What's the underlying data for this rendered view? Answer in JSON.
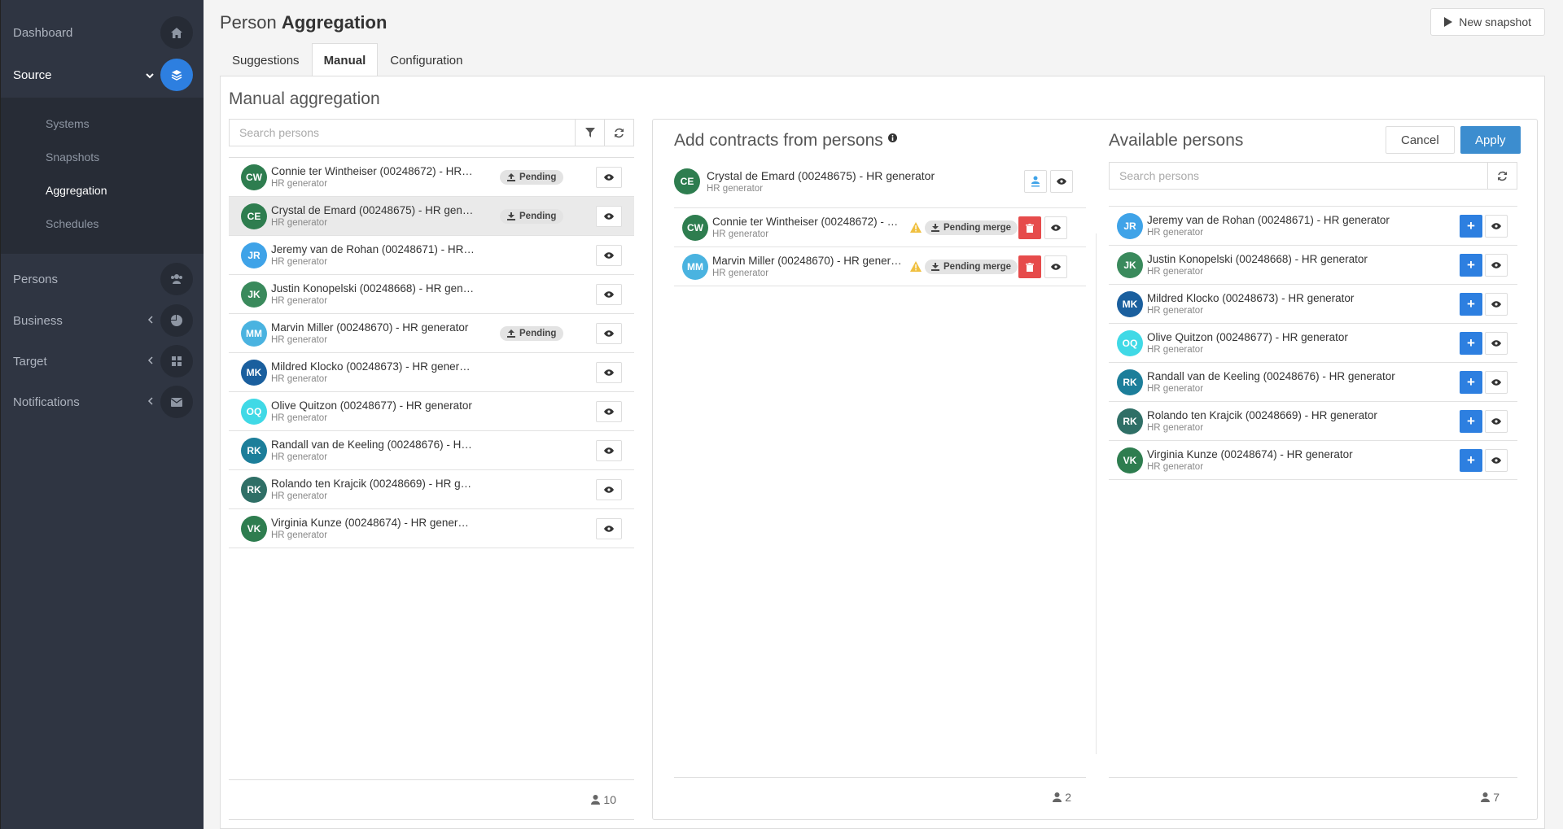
{
  "sidebar": {
    "dashboard": "Dashboard",
    "source": "Source",
    "sub": [
      "Systems",
      "Snapshots",
      "Aggregation",
      "Schedules"
    ],
    "persons": "Persons",
    "business": "Business",
    "target": "Target",
    "notifications": "Notifications"
  },
  "header": {
    "title_light": "Person",
    "title_bold": "Aggregation",
    "new_snapshot": "New snapshot"
  },
  "tabs": [
    "Suggestions",
    "Manual",
    "Configuration"
  ],
  "manual": {
    "title": "Manual aggregation",
    "search_placeholder": "Search persons",
    "count": "10",
    "persons": [
      {
        "initials": "CW",
        "name": "Connie ter Wintheiser (00248672) - HR g...",
        "sub": "HR generator",
        "status": "Pending",
        "color": "#2e7d4f"
      },
      {
        "initials": "CE",
        "name": "Crystal de Emard (00248675) - HR gener...",
        "sub": "HR generator",
        "status": "Pending",
        "color": "#2e7d4f"
      },
      {
        "initials": "JR",
        "name": "Jeremy van de Rohan (00248671) - HR g...",
        "sub": "HR generator",
        "status": "",
        "color": "#3fa3e8"
      },
      {
        "initials": "JK",
        "name": "Justin Konopelski (00248668) - HR gener...",
        "sub": "HR generator",
        "status": "",
        "color": "#3a8a5c"
      },
      {
        "initials": "MM",
        "name": "Marvin Miller (00248670) - HR generator",
        "sub": "HR generator",
        "status": "Pending",
        "color": "#4ab3e0"
      },
      {
        "initials": "MK",
        "name": "Mildred Klocko (00248673) - HR generat...",
        "sub": "HR generator",
        "status": "",
        "color": "#1a5f9e"
      },
      {
        "initials": "OQ",
        "name": "Olive Quitzon (00248677) - HR generator",
        "sub": "HR generator",
        "status": "",
        "color": "#40d9e6"
      },
      {
        "initials": "RK",
        "name": "Randall van de Keeling (00248676) - HR ...",
        "sub": "HR generator",
        "status": "",
        "color": "#1c7e9a"
      },
      {
        "initials": "RK",
        "name": "Rolando ten Krajcik (00248669) - HR gen...",
        "sub": "HR generator",
        "status": "",
        "color": "#2f6f66"
      },
      {
        "initials": "VK",
        "name": "Virginia Kunze (00248674) - HR generator",
        "sub": "HR generator",
        "status": "",
        "color": "#2e7d4f"
      }
    ]
  },
  "contracts": {
    "title": "Add contracts from persons",
    "target": {
      "initials": "CE",
      "name": "Crystal de Emard (00248675) - HR generator",
      "sub": "HR generator",
      "color": "#2e7d4f"
    },
    "count": "2",
    "merges": [
      {
        "initials": "CW",
        "name": "Connie ter Wintheiser (00248672) - H...",
        "sub": "HR generator",
        "status": "Pending merge",
        "color": "#2e7d4f"
      },
      {
        "initials": "MM",
        "name": "Marvin Miller (00248670) - HR genera...",
        "sub": "HR generator",
        "status": "Pending merge",
        "color": "#4ab3e0"
      }
    ]
  },
  "available": {
    "title": "Available persons",
    "cancel": "Cancel",
    "apply": "Apply",
    "search_placeholder": "Search persons",
    "count": "7",
    "persons": [
      {
        "initials": "JR",
        "name": "Jeremy van de Rohan (00248671) - HR generator",
        "sub": "HR generator",
        "color": "#3fa3e8"
      },
      {
        "initials": "JK",
        "name": "Justin Konopelski (00248668) - HR generator",
        "sub": "HR generator",
        "color": "#3a8a5c"
      },
      {
        "initials": "MK",
        "name": "Mildred Klocko (00248673) - HR generator",
        "sub": "HR generator",
        "color": "#1a5f9e"
      },
      {
        "initials": "OQ",
        "name": "Olive Quitzon (00248677) - HR generator",
        "sub": "HR generator",
        "color": "#40d9e6"
      },
      {
        "initials": "RK",
        "name": "Randall van de Keeling (00248676) - HR generator",
        "sub": "HR generator",
        "color": "#1c7e9a"
      },
      {
        "initials": "RK",
        "name": "Rolando ten Krajcik (00248669) - HR generator",
        "sub": "HR generator",
        "color": "#2f6f66"
      },
      {
        "initials": "VK",
        "name": "Virginia Kunze (00248674) - HR generator",
        "sub": "HR generator",
        "color": "#2e7d4f"
      }
    ]
  }
}
